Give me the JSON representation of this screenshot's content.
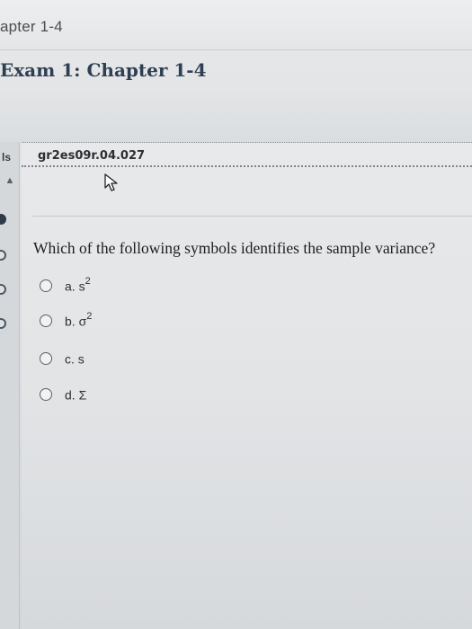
{
  "header": {
    "course_title": "apter 1-4",
    "exam_title": "Exam 1: Chapter 1-4"
  },
  "sidebar": {
    "label": "ls"
  },
  "question": {
    "id": "gr2es09r.04.027",
    "text": "Which of the following symbols identifies the sample variance?",
    "options": [
      {
        "letter": "a.",
        "symbol": "s",
        "sup": "2"
      },
      {
        "letter": "b.",
        "symbol": "σ",
        "sup": "2"
      },
      {
        "letter": "c.",
        "symbol": "s",
        "sup": ""
      },
      {
        "letter": "d.",
        "symbol": "Σ",
        "sup": ""
      }
    ]
  }
}
